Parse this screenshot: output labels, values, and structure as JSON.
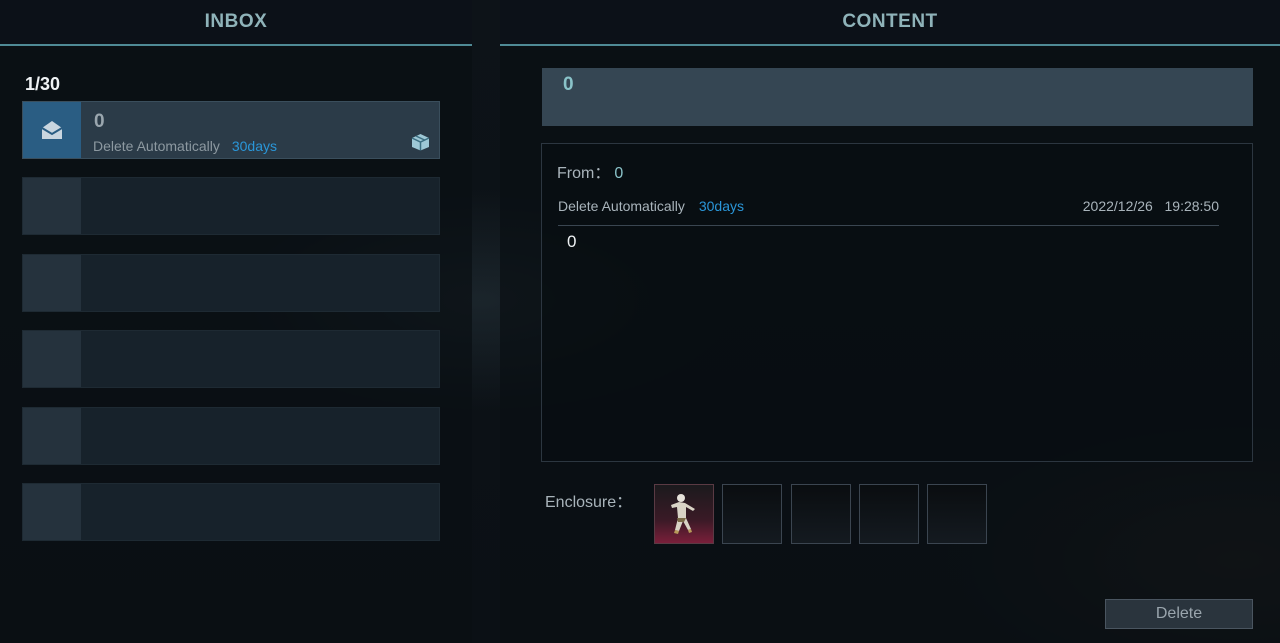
{
  "inbox": {
    "header": "INBOX",
    "count": "1/30",
    "items": [
      {
        "title": "0",
        "delete_label": "Delete Automatically",
        "days": "30days",
        "icon": "envelope-open-icon",
        "attachment_icon": "gift-box-icon",
        "active": true
      },
      {
        "empty": true
      },
      {
        "empty": true
      },
      {
        "empty": true
      },
      {
        "empty": true
      },
      {
        "empty": true
      }
    ]
  },
  "content": {
    "header": "CONTENT",
    "subject": "0",
    "from_label": "From：",
    "from_value": "0",
    "delete_label": "Delete Automatically",
    "days": "30days",
    "date": "2022/12/26",
    "time": "19:28:50",
    "body": "0",
    "enclosure_label": "Enclosure：",
    "enclosures": [
      "character-figure-item",
      "",
      "",
      "",
      ""
    ],
    "delete_button": "Delete"
  },
  "colors": {
    "accent": "#2a96d8",
    "header_underline": "#4f8a95",
    "subject_bg": "#354653",
    "active_thumb": "#2a5d83"
  }
}
